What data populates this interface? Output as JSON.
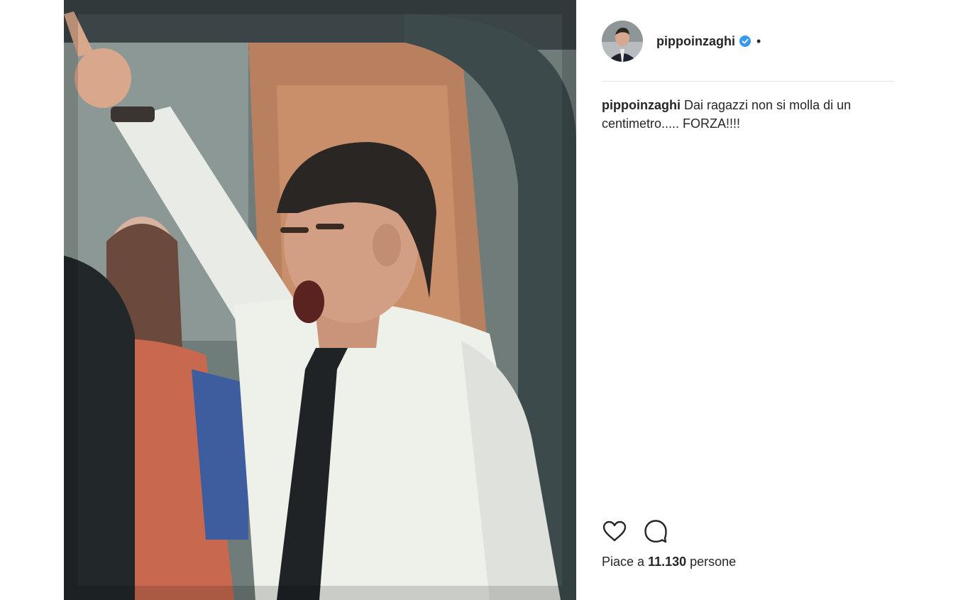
{
  "post": {
    "username": "pippoinzaghi",
    "header_separator": "•",
    "caption_text": "Dai ragazzi non si molla di un centimetro..... FORZA!!!!",
    "likes_prefix": "Piace a",
    "likes_count": "11.130",
    "likes_suffix": "persone"
  },
  "icons": {
    "verified": "verified-badge-icon",
    "like": "heart-icon",
    "comment": "comment-bubble-icon"
  },
  "colors": {
    "verified_blue": "#3897f0",
    "text": "#262626",
    "divider": "#e6e6e6"
  }
}
